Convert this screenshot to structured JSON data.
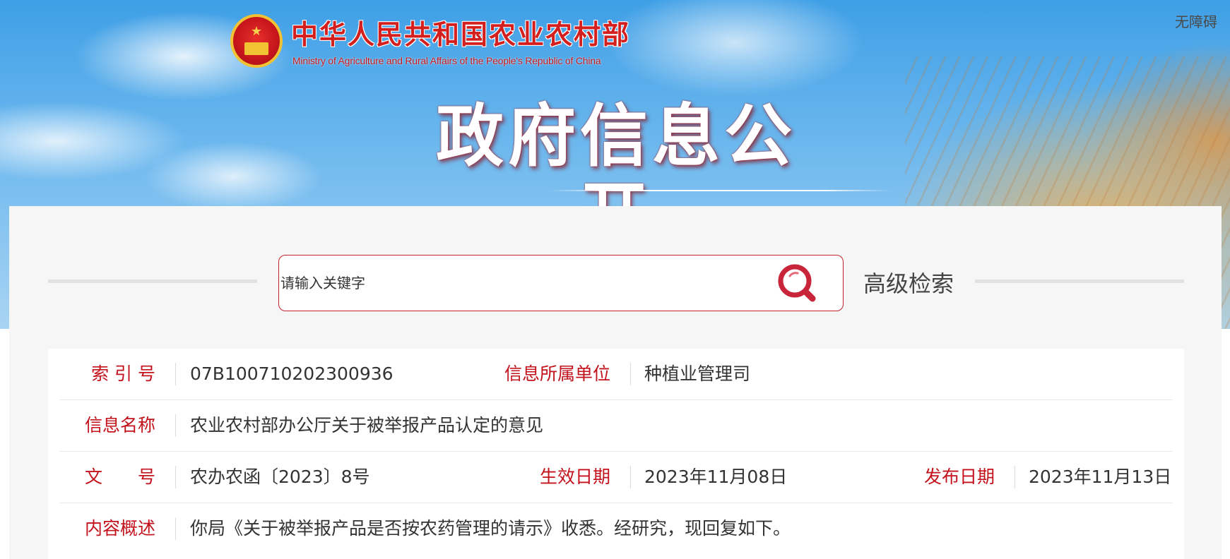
{
  "header": {
    "ministry_name_cn": "中华人民共和国农业农村部",
    "ministry_name_en": "Ministry of Agriculture and Rural Affairs of the People's Republic of China",
    "accessibility_label": "无障碍",
    "page_title": "政府信息公开"
  },
  "search": {
    "placeholder": "请输入关键字",
    "advanced_label": "高级检索"
  },
  "info": {
    "index_label": "索 引 号",
    "index_value": "07B100710202300936",
    "unit_label": "信息所属单位",
    "unit_value": "种植业管理司",
    "name_label": "信息名称",
    "name_value": "农业农村部办公厅关于被举报产品认定的意见",
    "doc_no_label": "文　　号",
    "doc_no_value": "农办农函〔2023〕8号",
    "effective_label": "生效日期",
    "effective_value": "2023年11月08日",
    "publish_label": "发布日期",
    "publish_value": "2023年11月13日",
    "summary_label": "内容概述",
    "summary_value": "你局《关于被举报产品是否按农药管理的请示》收悉。经研究，现回复如下。"
  },
  "colors": {
    "accent_red": "#c3121c",
    "panel_bg": "#f6f6f6"
  }
}
